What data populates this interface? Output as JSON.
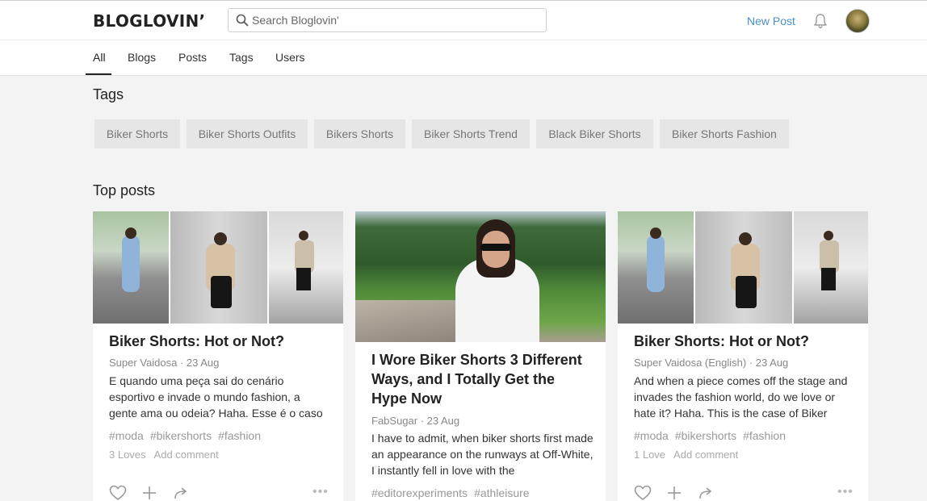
{
  "header": {
    "logo": "BLOGLOVIN’",
    "search_placeholder": "Search Bloglovin'",
    "new_post": "New Post",
    "icons": {
      "search": "search-icon",
      "bell": "bell-icon",
      "avatar": "user-avatar"
    },
    "accent_color": "#4a90c7"
  },
  "tabs": [
    {
      "label": "All",
      "active": true
    },
    {
      "label": "Blogs"
    },
    {
      "label": "Posts"
    },
    {
      "label": "Tags"
    },
    {
      "label": "Users"
    }
  ],
  "tags_section": {
    "title": "Tags",
    "chips": [
      "Biker Shorts",
      "Biker Shorts Outfits",
      "Bikers Shorts",
      "Biker Shorts Trend",
      "Black Biker Shorts",
      "Biker Shorts Fashion"
    ]
  },
  "top_posts": {
    "title": "Top posts",
    "cards": [
      {
        "title": "Biker Shorts: Hot or Not?",
        "author": "Super Vaidosa",
        "date": "23 Aug",
        "excerpt": "E quando uma peça sai do cenário esportivo e invade o mundo fashion, a gente ama ou odeia? Haha. Esse é o caso",
        "tags": [
          "#moda",
          "#bikershorts",
          "#fashion"
        ],
        "loves": "3 Loves",
        "add_comment": "Add comment"
      },
      {
        "title": "I Wore Biker Shorts 3 Different Ways, and I Totally Get the Hype Now",
        "author": "FabSugar",
        "date": "23 Aug",
        "excerpt": "I have to admit, when biker shorts first made an appearance on the runways at Off-White, I instantly fell in love with the",
        "tags": [
          "#editorexperiments",
          "#athleisure"
        ]
      },
      {
        "title": "Biker Shorts: Hot or Not?",
        "author": "Super Vaidosa (English)",
        "date": "23 Aug",
        "excerpt": "And when a piece comes off the stage and invades the fashion world, do we love or hate it? Haha. This is the case of Biker",
        "tags": [
          "#moda",
          "#bikershorts",
          "#fashion"
        ],
        "loves": "1 Love",
        "add_comment": "Add comment"
      }
    ]
  },
  "card_action_icons": [
    "heart-icon",
    "plus-icon",
    "share-icon",
    "more-icon"
  ]
}
